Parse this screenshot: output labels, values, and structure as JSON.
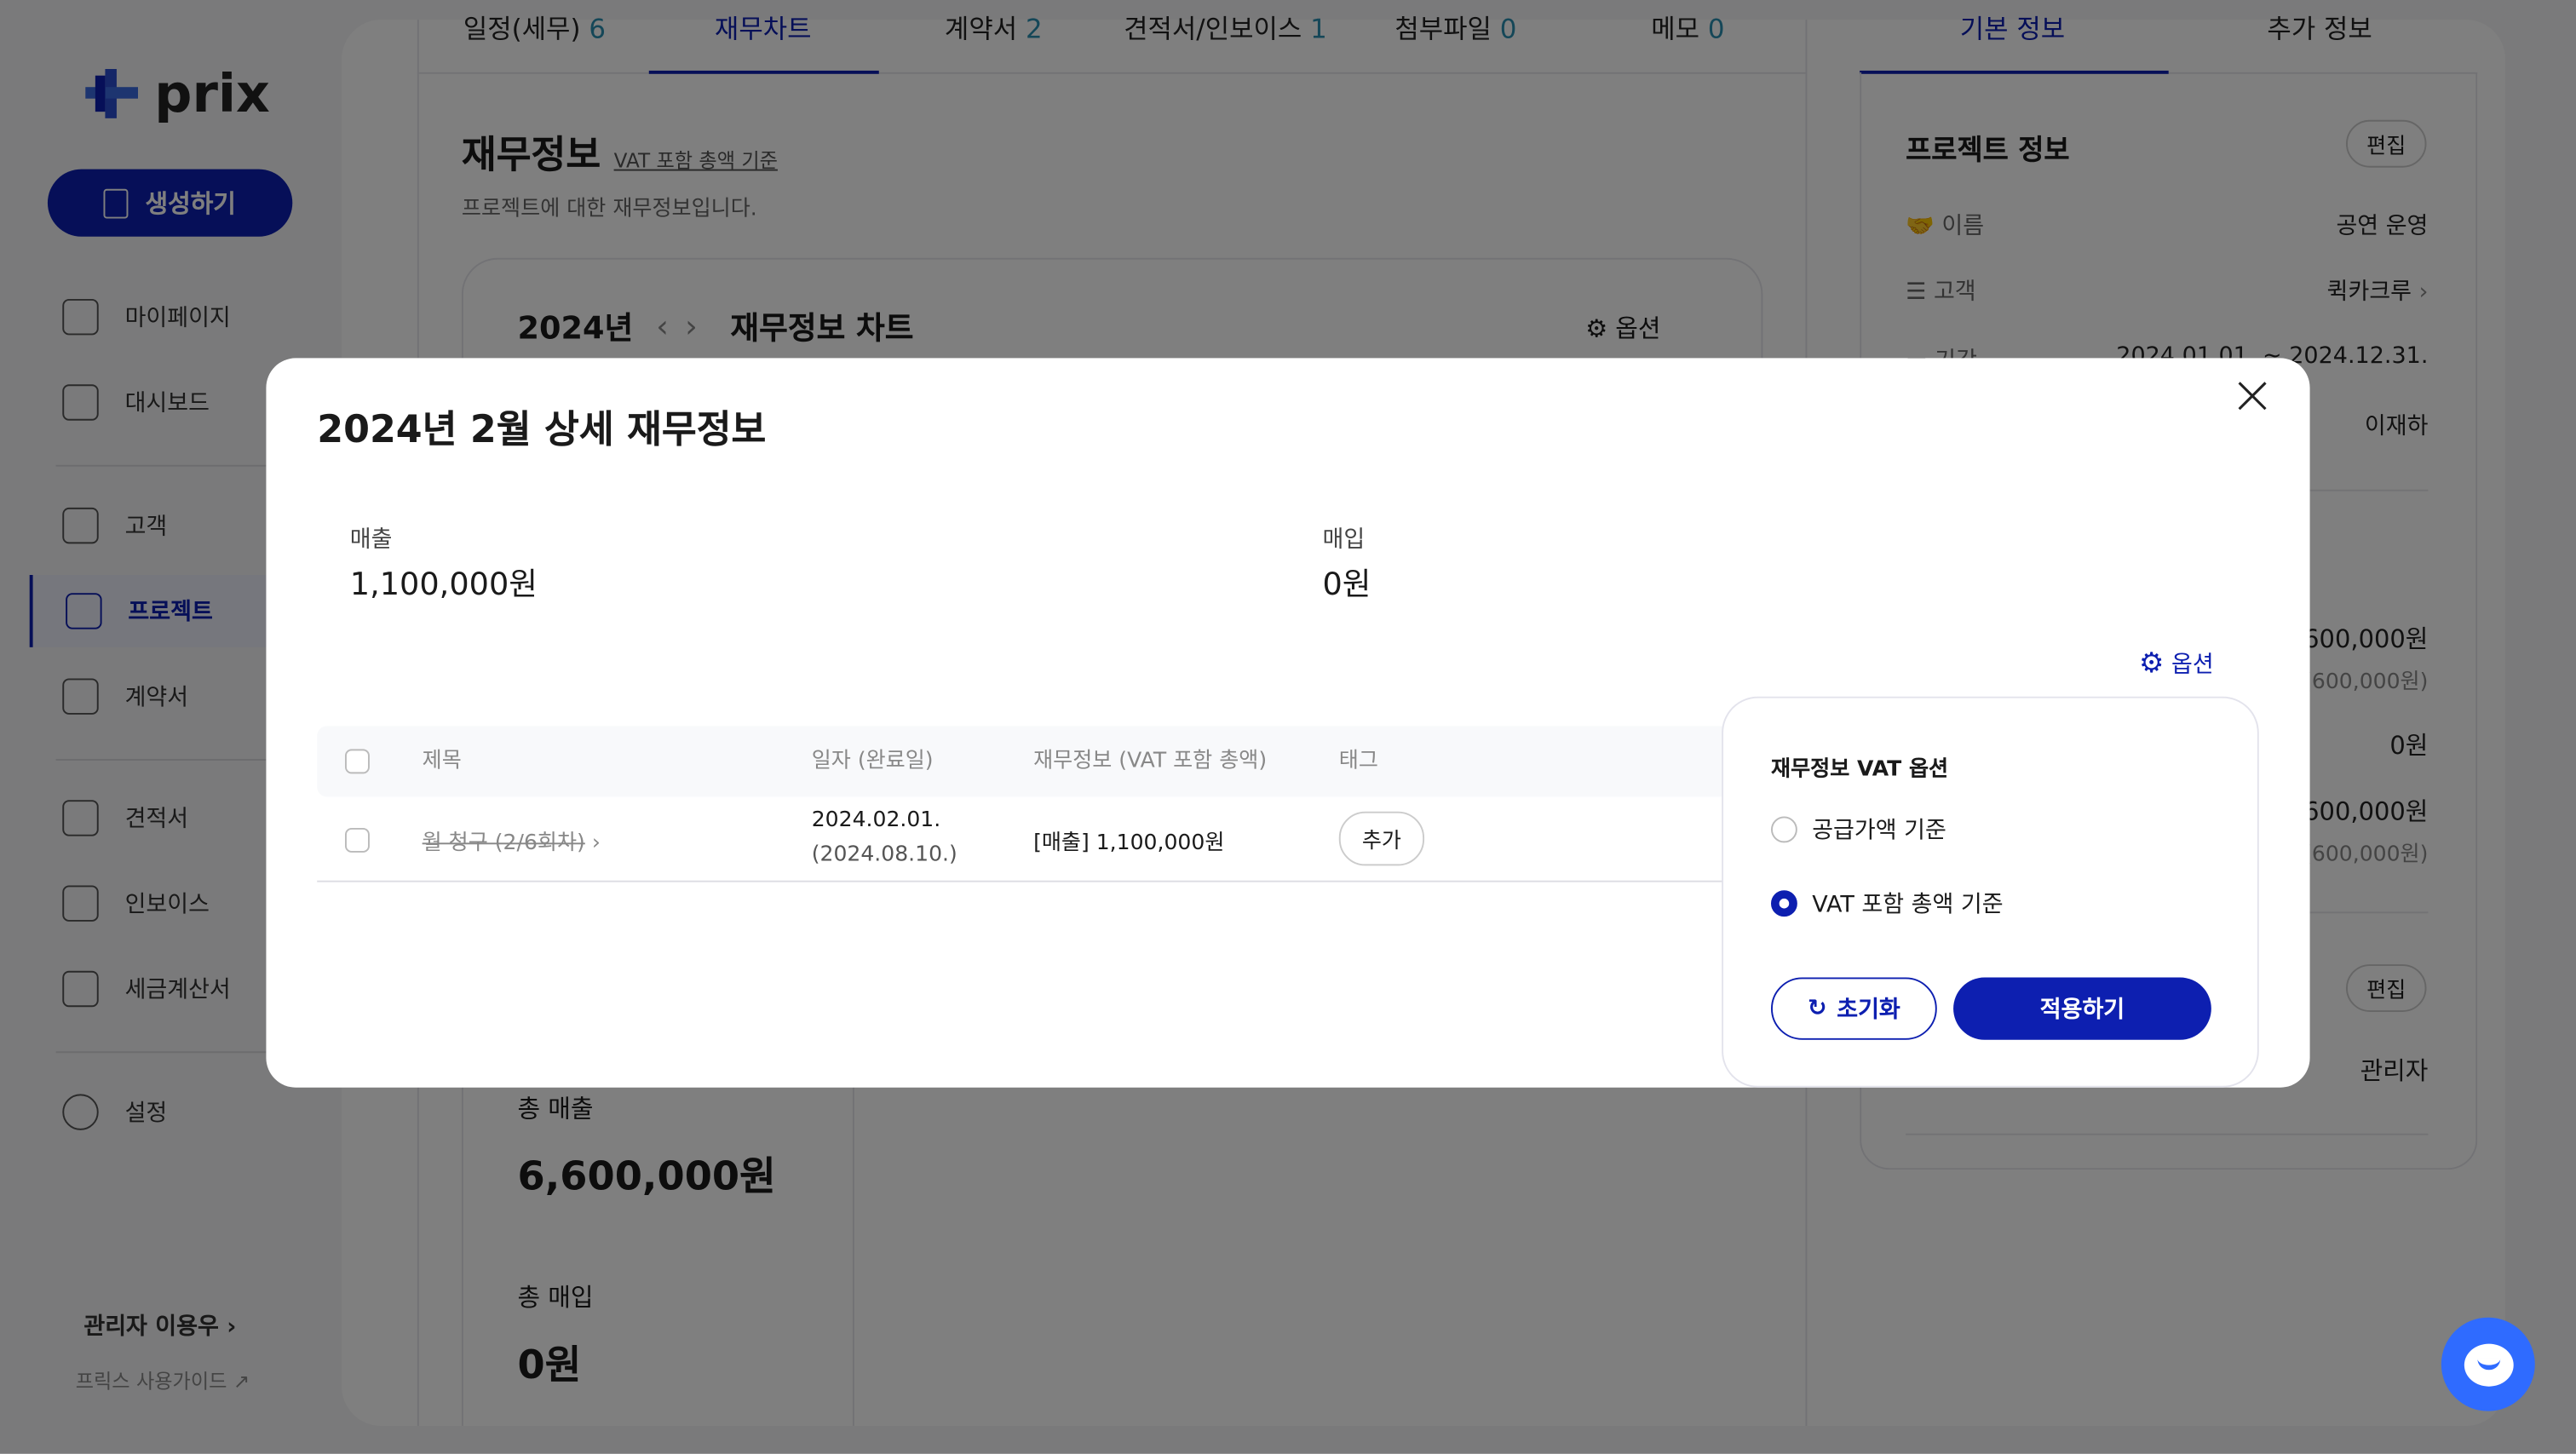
{
  "sidebar": {
    "logo_text": "prix",
    "create_button": "생성하기",
    "items": [
      {
        "label": "마이페이지",
        "icon": "grid-icon"
      },
      {
        "label": "대시보드",
        "icon": "chart-icon"
      },
      {
        "label": "고객",
        "icon": "briefcase-icon"
      },
      {
        "label": "프로젝트",
        "icon": "handshake-icon",
        "active": true
      },
      {
        "label": "계약서",
        "icon": "clipboard-icon"
      },
      {
        "label": "견적서",
        "icon": "bar-chart-icon"
      },
      {
        "label": "인보이스",
        "icon": "invoice-icon"
      },
      {
        "label": "세금계산서",
        "icon": "tax-icon"
      },
      {
        "label": "설정",
        "icon": "gear-icon"
      }
    ],
    "user": "관리자 이용우",
    "guide_link": "프릭스 사용가이드"
  },
  "main": {
    "tabs": [
      {
        "label": "일정(세무)",
        "count": "6"
      },
      {
        "label": "재무차트",
        "count": "",
        "active": true
      },
      {
        "label": "계약서",
        "count": "2"
      },
      {
        "label": "견적서/인보이스",
        "count": "1"
      },
      {
        "label": "첨부파일",
        "count": "0"
      },
      {
        "label": "메모",
        "count": "0"
      }
    ],
    "title": "재무정보",
    "title_note": "VAT 포함 총액 기준",
    "subtitle": "프로젝트에 대한 재무정보입니다.",
    "chart_card": {
      "year": "2024년",
      "title": "재무정보 차트",
      "options": "옵션"
    },
    "totals": {
      "sales_label": "총 매출",
      "sales_value": "6,600,000원",
      "purchase_label": "총 매입",
      "purchase_value": "0원"
    }
  },
  "right_panel": {
    "tabs": [
      {
        "label": "기본 정보",
        "active": true
      },
      {
        "label": "추가 정보"
      }
    ],
    "project_info_title": "프로젝트 정보",
    "edit": "편집",
    "rows": [
      {
        "label": "이름",
        "value": "공연 운영"
      },
      {
        "label": "고객",
        "value": "퀵카크루"
      },
      {
        "label": "기간",
        "value": "2024.01.01. ~ 2024.12.31."
      },
      {
        "label": "",
        "value": "이재하"
      }
    ],
    "finance": [
      "600,000원",
      "(600,000원)",
      "0원",
      "600,000원",
      "(600,000원)"
    ],
    "manager": "관리자"
  },
  "modal": {
    "title": "2024년 2월 상세 재무정보",
    "sales_label": "매출",
    "sales_value": "1,100,000원",
    "purchase_label": "매입",
    "purchase_value": "0원",
    "options_link": "옵션",
    "table": {
      "headers": [
        "제목",
        "일자 (완료일)",
        "재무정보 (VAT 포함 총액)",
        "태그"
      ],
      "rows": [
        {
          "title": "월 청구 (2/6회차)",
          "date": "2024.02.01.",
          "completed": "(2024.08.10.)",
          "finance": "[매출] 1,100,000원",
          "tag_button": "추가"
        }
      ]
    },
    "vat_popover": {
      "title": "재무정보 VAT 옵션",
      "options": [
        {
          "label": "공급가액 기준",
          "selected": false
        },
        {
          "label": "VAT 포함 총액 기준",
          "selected": true
        }
      ],
      "reset": "초기화",
      "apply": "적용하기"
    }
  },
  "colors": {
    "primary": "#0d1fb0",
    "chat": "#2f6bff"
  }
}
